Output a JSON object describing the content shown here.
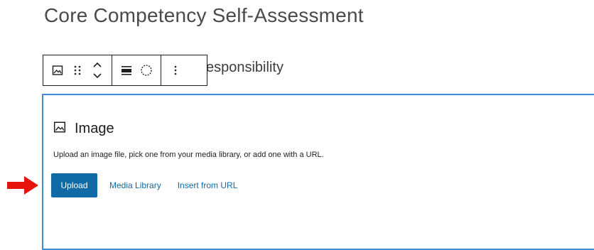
{
  "page": {
    "title": "Core Competency Self-Assessment"
  },
  "heading": {
    "text_visible": "esponsibility"
  },
  "toolbar": {
    "groups": [
      {
        "buttons": [
          "image-icon",
          "drag-handle-icon",
          "move-up-down-icon"
        ]
      },
      {
        "buttons": [
          "align-icon",
          "circle-crop-icon"
        ]
      },
      {
        "buttons": [
          "more-options-icon"
        ]
      }
    ]
  },
  "image_block": {
    "label": "Image",
    "instructions": "Upload an image file, pick one from your media library, or add one with a URL.",
    "upload_label": "Upload",
    "media_library_label": "Media Library",
    "insert_url_label": "Insert from URL"
  },
  "colors": {
    "accent": "#0f6aa6",
    "selection_border": "#3f8dd6",
    "annotation_arrow": "#e8140c"
  }
}
